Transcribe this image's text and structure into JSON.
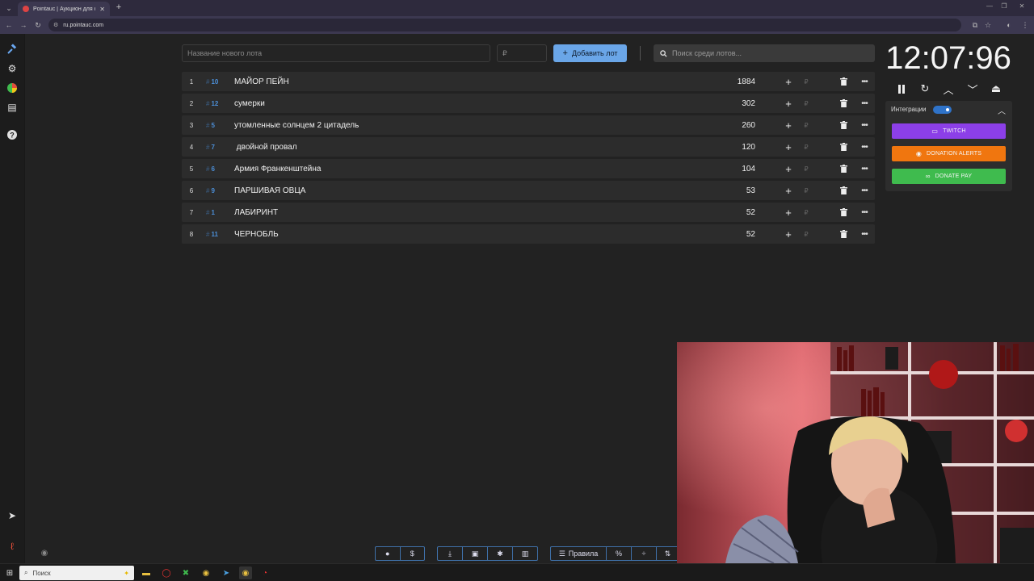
{
  "browser": {
    "tab_title": "Pointauc | Аукцион для стрима",
    "url": "ru.pointauc.com"
  },
  "toolbar": {
    "new_lot_placeholder": "Название нового лота",
    "amount_placeholder": "₽",
    "add_lot_label": "Добавить лот",
    "search_placeholder": "Поиск среди лотов..."
  },
  "lots": [
    {
      "index": "1",
      "fast_id": "10",
      "name": "МАЙОР ПЕЙН",
      "amount": "1884"
    },
    {
      "index": "2",
      "fast_id": "12",
      "name": "сумерки",
      "amount": "302"
    },
    {
      "index": "3",
      "fast_id": "5",
      "name": "утомленные солнцем 2 цитадель",
      "amount": "260"
    },
    {
      "index": "4",
      "fast_id": "7",
      "name": " двойной провал",
      "amount": "120"
    },
    {
      "index": "5",
      "fast_id": "6",
      "name": "Армия Франкенштейна",
      "amount": "104"
    },
    {
      "index": "6",
      "fast_id": "9",
      "name": "ПАРШИВАЯ ОВЦА",
      "amount": "53"
    },
    {
      "index": "7",
      "fast_id": "1",
      "name": "ЛАБИРИНТ",
      "amount": "52"
    },
    {
      "index": "8",
      "fast_id": "11",
      "name": "ЧЕРНОБЛЬ",
      "amount": "52"
    }
  ],
  "lot_currency": "₽",
  "timer": {
    "display": "12:07:96"
  },
  "integrations": {
    "label": "Интеграции",
    "enabled": true,
    "twitch_label": "TWITCH",
    "donation_alerts_label": "DONATION ALERTS",
    "donate_pay_label": "DONATE PAY",
    "colors": {
      "twitch": "#8c3fe8",
      "donation_alerts": "#f0760f",
      "donate_pay": "#3fbb4e"
    }
  },
  "bottom_toolbar": {
    "rules_label": "Правила",
    "dollar_label": "$",
    "percent_label": "%"
  },
  "taskbar": {
    "search_placeholder": "Поиск"
  },
  "colors": {
    "accent": "#6aa6e8",
    "background": "#222222",
    "row": "#2c2c2c"
  }
}
